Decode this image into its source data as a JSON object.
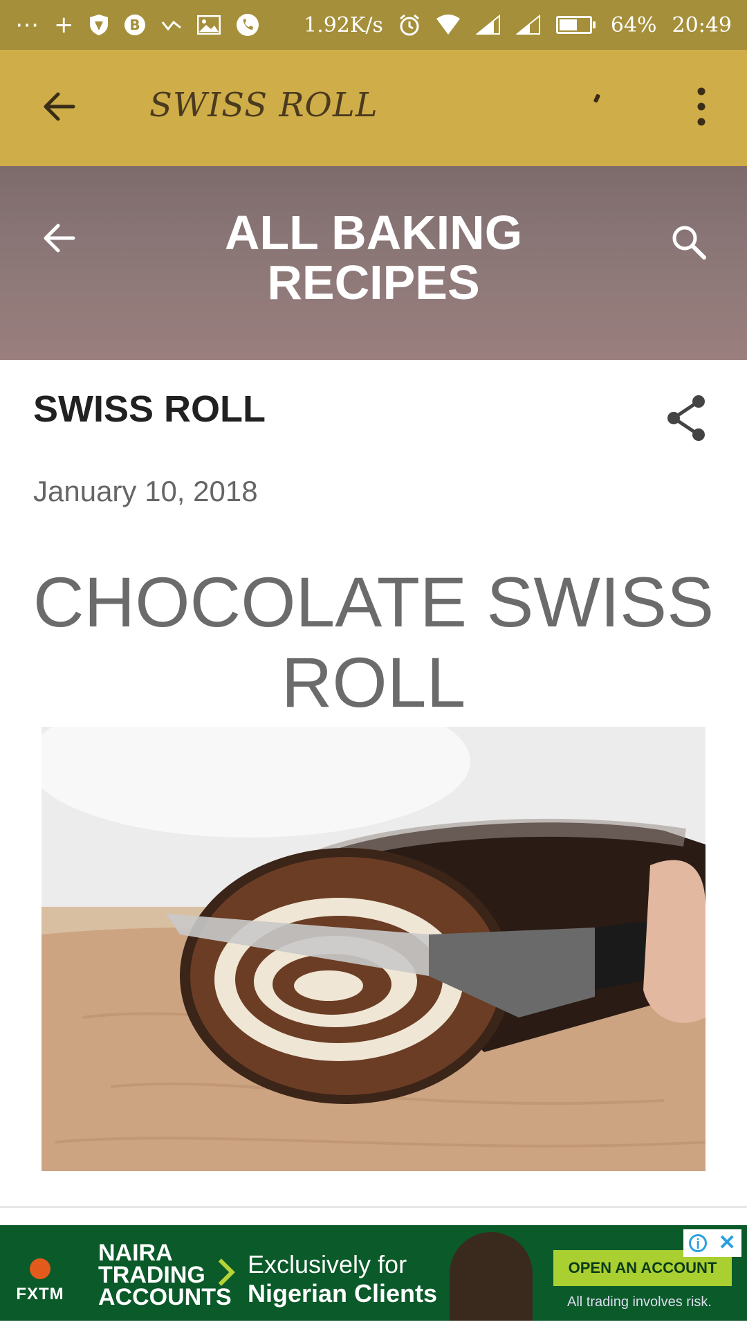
{
  "status_bar": {
    "left_icons": [
      "more-dots-icon",
      "plus-icon",
      "shield-icon",
      "bitcoin-icon",
      "check-icon",
      "image-icon",
      "phone-icon"
    ],
    "net_speed": "1.92K/s",
    "right_icons": [
      "alarm-icon",
      "wifi-icon",
      "signal-icon",
      "signal-icon"
    ],
    "battery_level": 0.64,
    "battery_text": "64%",
    "time": "20:49"
  },
  "app_bar": {
    "title": "SWISS ROLL",
    "background": "#cfad48"
  },
  "banner": {
    "title": "ALL BAKING RECIPES"
  },
  "post": {
    "title": "SWISS ROLL",
    "date": "January 10, 2018",
    "heading": "CHOCOLATE SWISS ROLL"
  },
  "ad": {
    "brand": "FXTM",
    "headline": "NAIRA TRADING ACCOUNTS",
    "tagline_line1": "Exclusively for",
    "tagline_line2": "Nigerian Clients",
    "cta": "OPEN AN ACCOUNT",
    "disclaimer": "All trading involves risk."
  }
}
